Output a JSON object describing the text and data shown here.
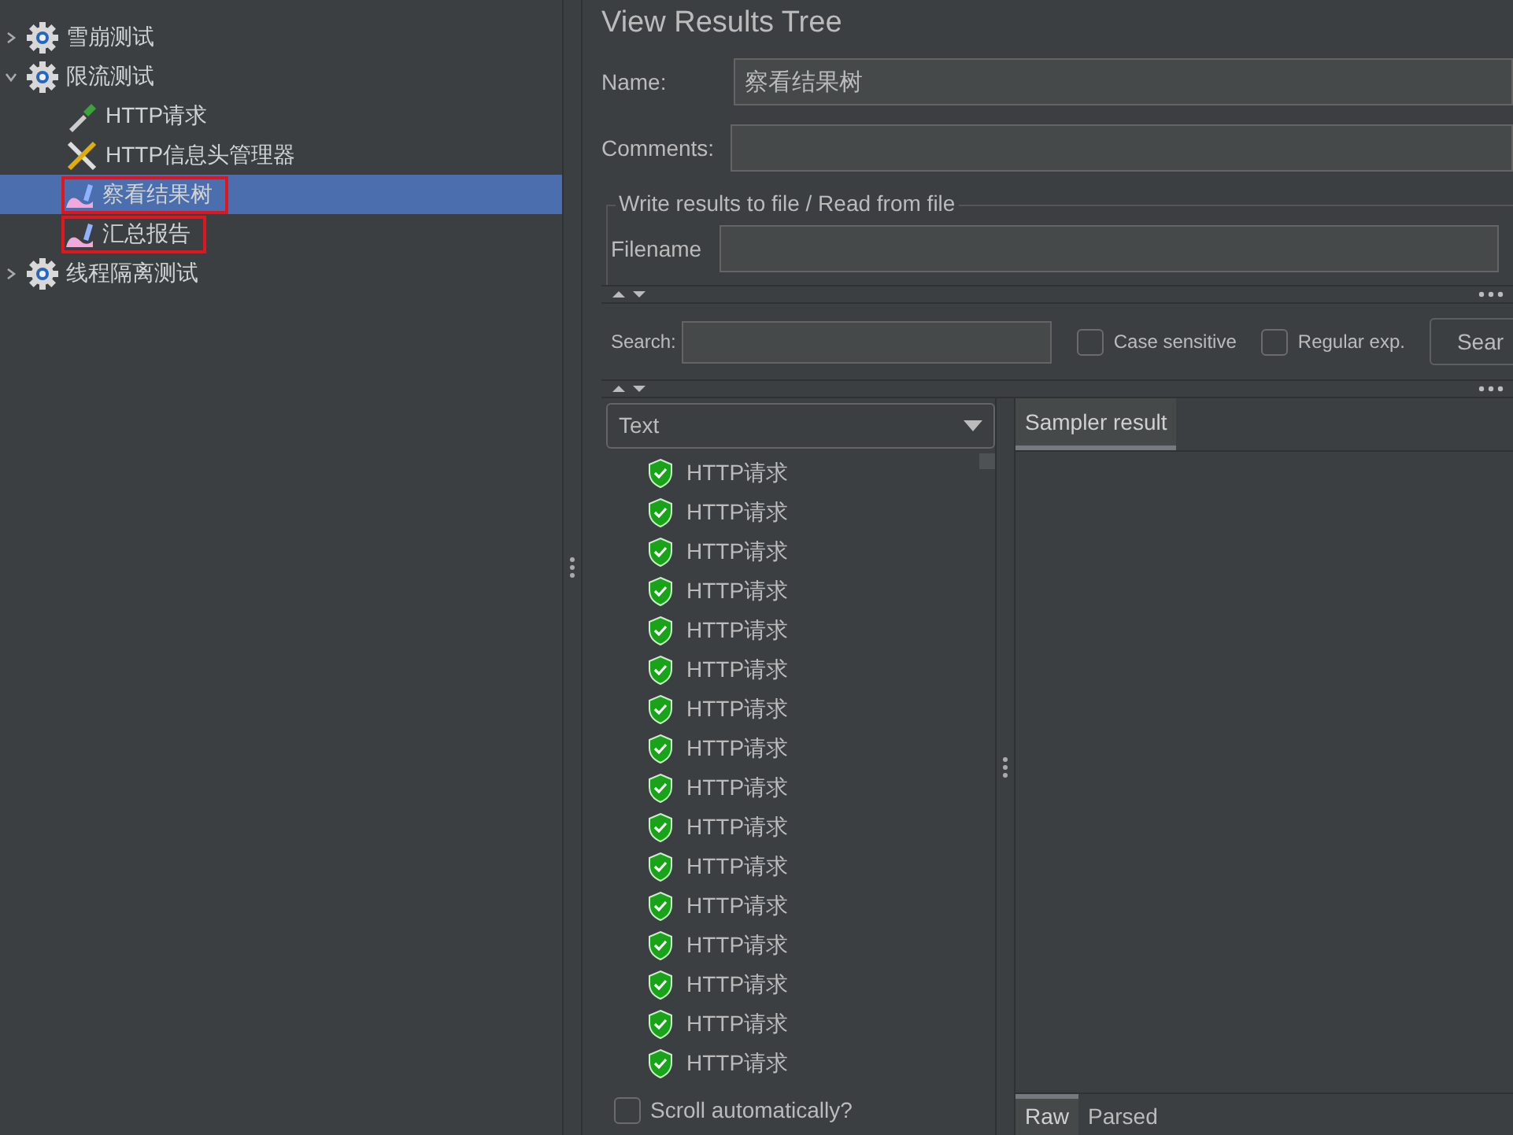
{
  "tree": [
    {
      "label": "雪崩测试",
      "kind": "group",
      "expanded": false,
      "selected": false,
      "marked": false
    },
    {
      "label": "限流测试",
      "kind": "group",
      "expanded": true,
      "selected": false,
      "marked": false,
      "children": [
        {
          "label": "HTTP请求",
          "kind": "sampler",
          "selected": false,
          "marked": false
        },
        {
          "label": "HTTP信息头管理器",
          "kind": "config",
          "selected": false,
          "marked": false
        },
        {
          "label": "察看结果树",
          "kind": "listener",
          "selected": true,
          "marked": true
        },
        {
          "label": "汇总报告",
          "kind": "listener",
          "selected": false,
          "marked": true
        }
      ]
    },
    {
      "label": "线程隔离测试",
      "kind": "group",
      "expanded": false,
      "selected": false,
      "marked": false
    }
  ],
  "panel": {
    "title": "View Results Tree",
    "name_label": "Name:",
    "name_value": "察看结果树",
    "comments_label": "Comments:",
    "file_group_title": "Write results to file / Read from file",
    "filename_label": "Filename"
  },
  "search": {
    "label": "Search:",
    "options": [
      {
        "label": "Case sensitive",
        "checked": false
      },
      {
        "label": "Regular exp.",
        "checked": false
      }
    ],
    "button": "Sear"
  },
  "renderer": "Text",
  "results": [
    "HTTP请求",
    "HTTP请求",
    "HTTP请求",
    "HTTP请求",
    "HTTP请求",
    "HTTP请求",
    "HTTP请求",
    "HTTP请求",
    "HTTP请求",
    "HTTP请求",
    "HTTP请求",
    "HTTP请求",
    "HTTP请求",
    "HTTP请求",
    "HTTP请求",
    "HTTP请求"
  ],
  "scroll_auto": {
    "label": "Scroll automatically?",
    "checked": false
  },
  "result_tabs": [
    {
      "label": "Sampler result",
      "selected": true
    }
  ],
  "view_tabs": [
    {
      "label": "Raw",
      "selected": true
    },
    {
      "label": "Parsed",
      "selected": false
    }
  ]
}
